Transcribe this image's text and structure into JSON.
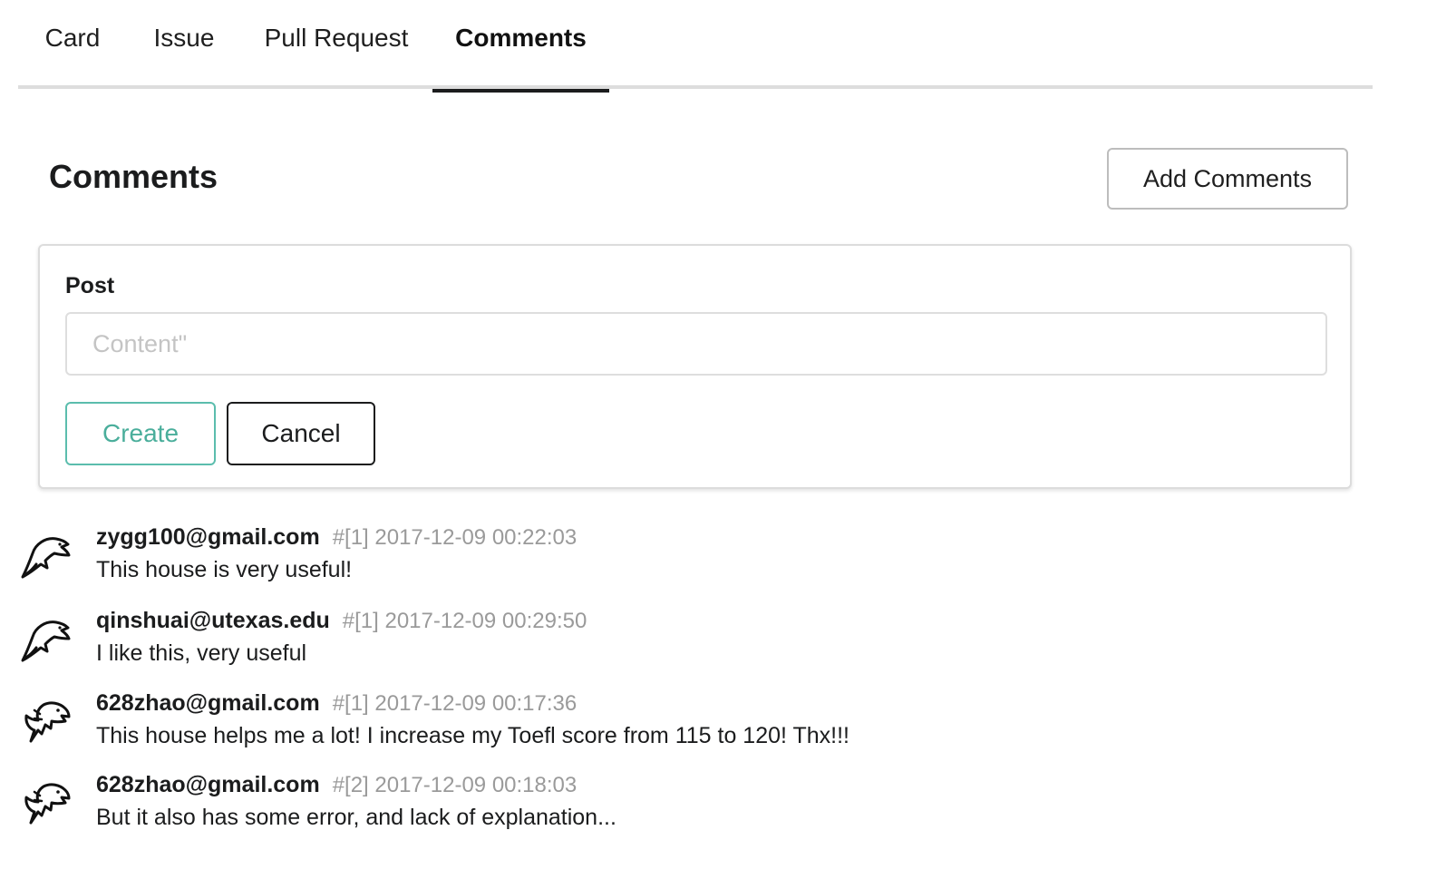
{
  "tabs": [
    {
      "label": "Card",
      "active": false
    },
    {
      "label": "Issue",
      "active": false
    },
    {
      "label": "Pull Request",
      "active": false
    },
    {
      "label": "Comments",
      "active": true
    }
  ],
  "header": {
    "title": "Comments",
    "add_button_label": "Add Comments"
  },
  "post_form": {
    "label": "Post",
    "content_placeholder": "Content\"",
    "content_value": "",
    "create_label": "Create",
    "cancel_label": "Cancel"
  },
  "comments": [
    {
      "author": "zygg100@gmail.com",
      "date": "#[1] 2017-12-09 00:22:03",
      "text": "This house is very useful!",
      "avatar_icon": "dolphin-icon"
    },
    {
      "author": "qinshuai@utexas.edu",
      "date": "#[1] 2017-12-09 00:29:50",
      "text": "I like this, very useful",
      "avatar_icon": "dolphin-icon"
    },
    {
      "author": "628zhao@gmail.com",
      "date": "#[1] 2017-12-09 00:17:36",
      "text": "This house helps me a lot! I increase my Toefl score from 115 to 120! Thx!!!",
      "avatar_icon": "eagle-icon"
    },
    {
      "author": "628zhao@gmail.com",
      "date": "#[2] 2017-12-09 00:18:03",
      "text": "But it also has some error, and lack of explanation...",
      "avatar_icon": "eagle-icon"
    }
  ],
  "colors": {
    "create_accent": "#5bbdad",
    "active_tab_underline": "#1b1c1d",
    "meta_gray": "#9a9a9a"
  }
}
